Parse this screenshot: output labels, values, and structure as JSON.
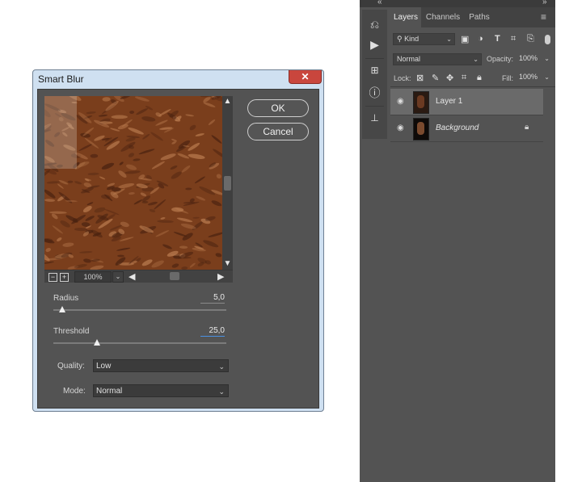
{
  "dialog": {
    "title": "Smart Blur",
    "close_glyph": "✕",
    "ok_label": "OK",
    "cancel_label": "Cancel",
    "zoom": "100%",
    "radius": {
      "label": "Radius",
      "value": "5,0",
      "level": 0.05
    },
    "threshold": {
      "label": "Threshold",
      "value": "25,0",
      "level": 0.25
    },
    "quality": {
      "label": "Quality:",
      "value": "Low"
    },
    "mode": {
      "label": "Mode:",
      "value": "Normal"
    },
    "zoom_out_glyph": "−",
    "zoom_in_glyph": "+",
    "colors": {
      "preview_base": "#7a3e1c",
      "preview_highlight": "#b87a4e",
      "preview_shadow": "#4a2210"
    }
  },
  "layers_panel": {
    "tabs": [
      "Layers",
      "Channels",
      "Paths"
    ],
    "filter_kind": "Kind",
    "blend_mode": "Normal",
    "opacity_label": "Opacity:",
    "opacity_value": "100%",
    "lock_label": "Lock:",
    "fill_label": "Fill:",
    "fill_value": "100%",
    "layers": [
      {
        "name": "Layer 1",
        "selected": true,
        "visible": true
      },
      {
        "name": "Background",
        "selected": false,
        "visible": true,
        "locked": true
      }
    ],
    "icons": {
      "collapse_left": "«",
      "collapse_right": "»",
      "menu": "≡",
      "history": "history-icon",
      "play": "play-icon",
      "navigator": "navigator-icon",
      "info": "info-icon",
      "clone_source": "clone-source-icon"
    }
  }
}
